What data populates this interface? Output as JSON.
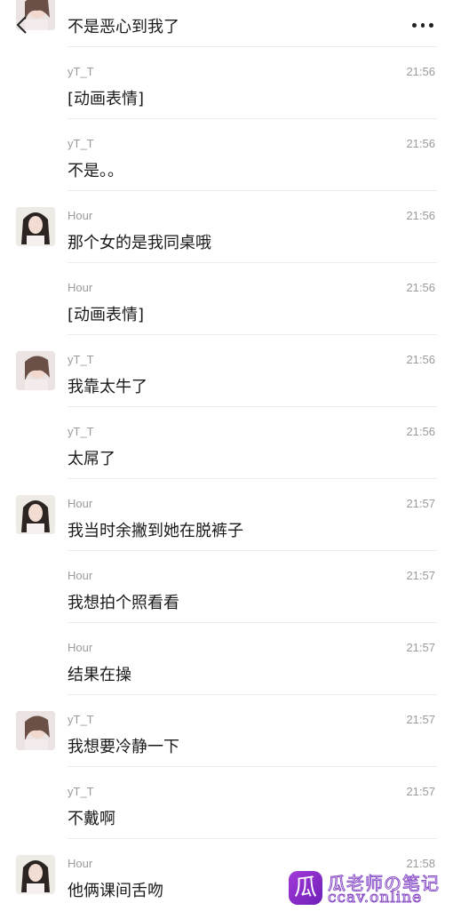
{
  "messages": [
    {
      "name": "",
      "time": "",
      "text": "不是恶心到我了",
      "avatar": "girl-b"
    },
    {
      "name": "yT_T",
      "time": "21:56",
      "text": "[动画表情]",
      "avatar": ""
    },
    {
      "name": "yT_T",
      "time": "21:56",
      "text": "不是。。",
      "avatar": ""
    },
    {
      "name": "Hour",
      "time": "21:56",
      "text": "那个女的是我同桌哦",
      "avatar": "girl-a"
    },
    {
      "name": "Hour",
      "time": "21:56",
      "text": "[动画表情]",
      "avatar": ""
    },
    {
      "name": "yT_T",
      "time": "21:56",
      "text": "我靠太牛了",
      "avatar": "girl-b"
    },
    {
      "name": "yT_T",
      "time": "21:56",
      "text": "太屌了",
      "avatar": ""
    },
    {
      "name": "Hour",
      "time": "21:57",
      "text": "我当时余撇到她在脱裤子",
      "avatar": "girl-a"
    },
    {
      "name": "Hour",
      "time": "21:57",
      "text": "我想拍个照看看",
      "avatar": ""
    },
    {
      "name": "Hour",
      "time": "21:57",
      "text": "结果在操",
      "avatar": ""
    },
    {
      "name": "yT_T",
      "time": "21:57",
      "text": "我想要冷静一下",
      "avatar": "girl-b"
    },
    {
      "name": "yT_T",
      "time": "21:57",
      "text": "不戴啊",
      "avatar": ""
    },
    {
      "name": "Hour",
      "time": "21:58",
      "text": "他俩课间舌吻",
      "avatar": "girl-a"
    }
  ],
  "topbar": {
    "back_icon": "chevron-left-icon",
    "more_icon": "more-dots-icon"
  },
  "watermark": {
    "logo_char": "瓜",
    "title": "瓜老师の笔记",
    "url": "ccav.online"
  }
}
